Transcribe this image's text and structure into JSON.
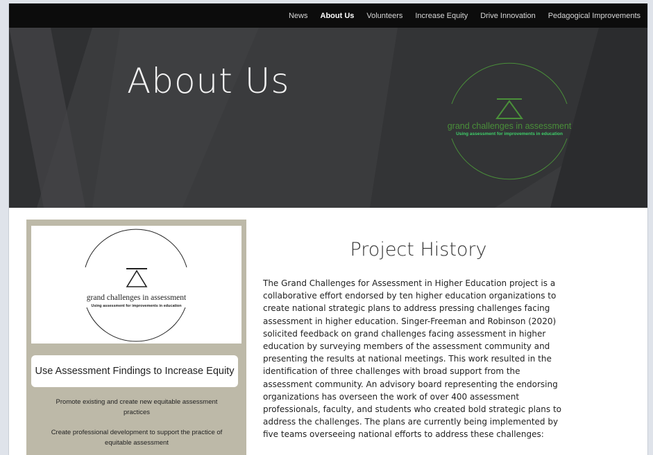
{
  "nav": {
    "items": [
      {
        "label": "News",
        "active": false
      },
      {
        "label": "About Us",
        "active": true
      },
      {
        "label": "Volunteers",
        "active": false
      },
      {
        "label": "Increase Equity",
        "active": false
      },
      {
        "label": "Drive Innovation",
        "active": false
      },
      {
        "label": "Pedagogical Improvements",
        "active": false
      }
    ]
  },
  "hero": {
    "title": "About Us",
    "logo_text": "grand challenges in assessment",
    "logo_subtext": "Using assessment for improvements in education",
    "logo_color": "#4a8f3a",
    "logo_sub_color": "#3fd06a",
    "background_color": "#3a3b3d"
  },
  "card": {
    "logo_text": "grand challenges in assessment",
    "logo_subtext": "Using assessment for improvements in education",
    "button_label": "Use Assessment Findings to Increase Equity",
    "items": [
      "Promote existing and create new equitable assessment practices",
      "Create professional development to support the practice of equitable assessment"
    ],
    "background_color": "#bdb9a8"
  },
  "section": {
    "title": "Project History",
    "body": "The Grand Challenges for Assessment in Higher Education project is a collaborative effort endorsed by ten higher education organizations to create national strategic plans to address pressing challenges facing assessment in higher education. Singer-Freeman and Robinson (2020) solicited feedback on grand challenges facing assessment in higher education by surveying members of the assessment community and presenting the results at national meetings. This work resulted in the identification of three challenges with broad support from the assessment community. An advisory board representing the endorsing organizations has overseen the work of over 400 assessment professionals, faculty, and students who created bold strategic plans to address the challenges.  The plans are currently being implemented by five teams overseeing national efforts to address these challenges:"
  }
}
